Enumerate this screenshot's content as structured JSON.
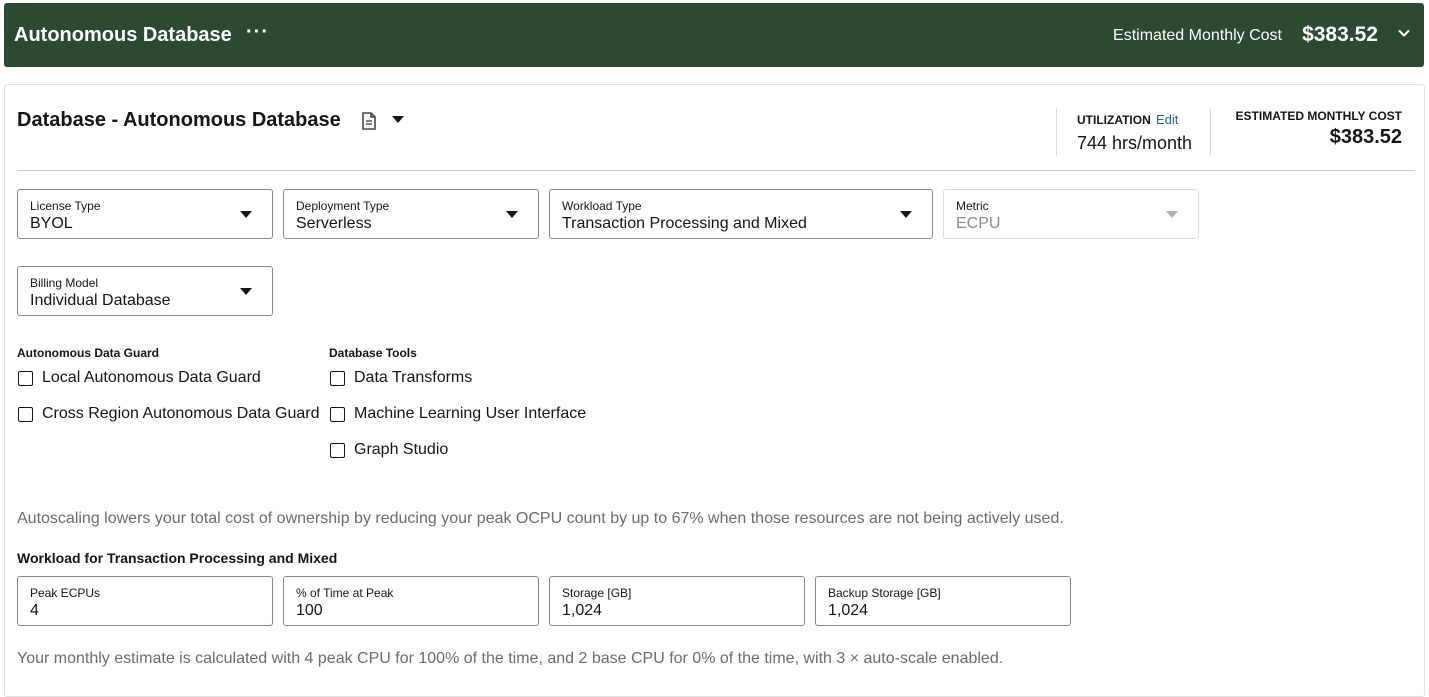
{
  "topbar": {
    "title": "Autonomous Database",
    "menu_label": "···",
    "cost_label": "Estimated Monthly Cost",
    "cost_value": "$383.52"
  },
  "panel": {
    "title": "Database - Autonomous Database",
    "utilization_label": "UTILIZATION",
    "utilization_edit": "Edit",
    "utilization_value": "744 hrs/month",
    "estimated_cost_label": "ESTIMATED MONTHLY COST",
    "estimated_cost_value": "$383.52"
  },
  "selects": {
    "license_type": {
      "label": "License Type",
      "value": "BYOL"
    },
    "deployment_type": {
      "label": "Deployment Type",
      "value": "Serverless"
    },
    "workload_type": {
      "label": "Workload Type",
      "value": "Transaction Processing and Mixed"
    },
    "metric": {
      "label": "Metric",
      "value": "ECPU"
    },
    "billing_model": {
      "label": "Billing Model",
      "value": "Individual Database"
    }
  },
  "data_guard": {
    "label": "Autonomous Data Guard",
    "options": [
      "Local Autonomous Data Guard",
      "Cross Region Autonomous Data Guard"
    ]
  },
  "database_tools": {
    "label": "Database Tools",
    "options": [
      "Data Transforms",
      "Machine Learning User Interface",
      "Graph Studio"
    ]
  },
  "autoscaling_note": "Autoscaling lowers your total cost of ownership by reducing your peak OCPU count by up to 67% when those resources are not being actively used.",
  "workload": {
    "section_label": "Workload for Transaction Processing and Mixed",
    "fields": {
      "peak_ecpus": {
        "label": "Peak ECPUs",
        "value": "4"
      },
      "pct_time_peak": {
        "label": "% of Time at Peak",
        "value": "100"
      },
      "storage": {
        "label": "Storage [GB]",
        "value": "1,024"
      },
      "backup_storage": {
        "label": "Backup Storage [GB]",
        "value": "1,024"
      }
    }
  },
  "estimate_note": "Your monthly estimate is calculated with 4 peak CPU for 100% of the time, and 2 base CPU for 0% of the time, with 3 × auto-scale enabled.",
  "colors": {
    "header_bg": "#2c4a32",
    "link": "#1b6b80"
  }
}
